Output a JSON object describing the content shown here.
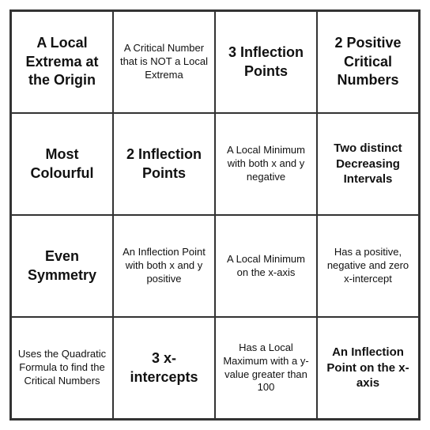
{
  "grid": {
    "cells": [
      {
        "id": "r0c0",
        "text": "A Local Extrema at the Origin",
        "style": "large-text"
      },
      {
        "id": "r0c1",
        "text": "A Critical Number that is NOT a Local Extrema",
        "style": "normal"
      },
      {
        "id": "r0c2",
        "text": "3 Inflection Points",
        "style": "large-text"
      },
      {
        "id": "r0c3",
        "text": "2 Positive Critical Numbers",
        "style": "large-text"
      },
      {
        "id": "r1c0",
        "text": "Most Colourful",
        "style": "large-text"
      },
      {
        "id": "r1c1",
        "text": "2 Inflection Points",
        "style": "large-text"
      },
      {
        "id": "r1c2",
        "text": "A Local Minimum with both x and y negative",
        "style": "normal"
      },
      {
        "id": "r1c3",
        "text": "Two distinct Decreasing Intervals",
        "style": "medium-text"
      },
      {
        "id": "r2c0",
        "text": "Even Symmetry",
        "style": "large-text"
      },
      {
        "id": "r2c1",
        "text": "An Inflection Point with both x and y positive",
        "style": "normal"
      },
      {
        "id": "r2c2",
        "text": "A Local Minimum on the x-axis",
        "style": "normal"
      },
      {
        "id": "r2c3",
        "text": "Has a positive, negative and zero x-intercept",
        "style": "normal"
      },
      {
        "id": "r3c0",
        "text": "Uses the Quadratic Formula to find the Critical Numbers",
        "style": "normal"
      },
      {
        "id": "r3c1",
        "text": "3 x-intercepts",
        "style": "large-text"
      },
      {
        "id": "r3c2",
        "text": "Has a Local Maximum with a y-value greater than 100",
        "style": "normal"
      },
      {
        "id": "r3c3",
        "text": "An Inflection Point on the x-axis",
        "style": "medium-text"
      }
    ]
  }
}
